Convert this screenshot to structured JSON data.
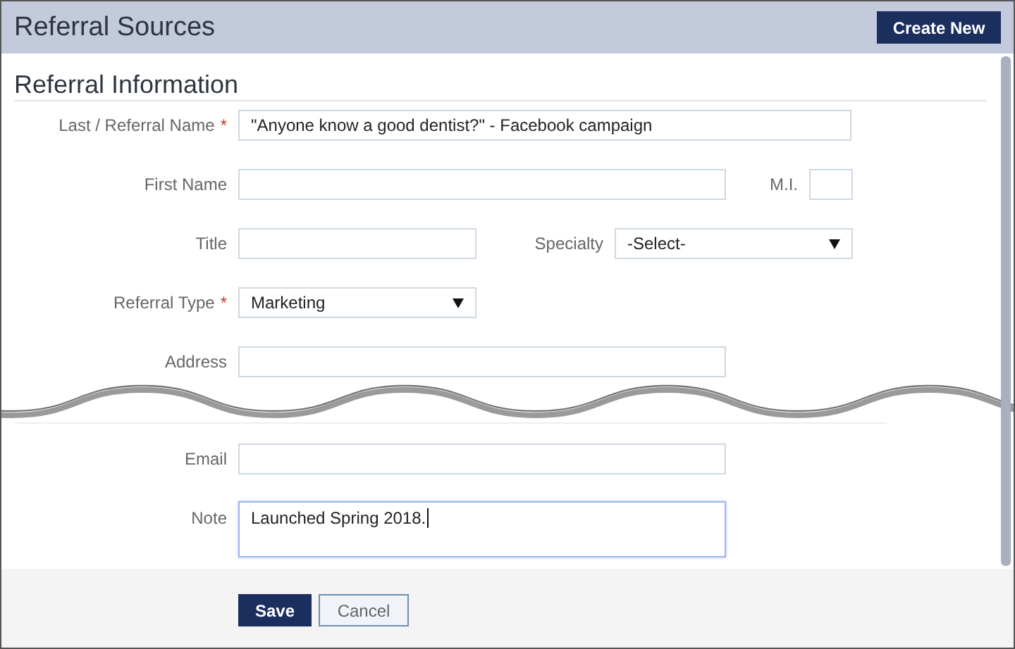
{
  "header": {
    "title": "Referral Sources",
    "create_button": "Create New"
  },
  "section": {
    "title": "Referral Information"
  },
  "last_name": {
    "label": "Last / Referral Name",
    "required_mark": "*",
    "value": "\"Anyone know a good dentist?\" - Facebook campaign"
  },
  "first_name": {
    "label": "First Name"
  },
  "middle_initial": {
    "label": "M.I."
  },
  "title": {
    "label": "Title"
  },
  "specialty": {
    "label": "Specialty",
    "value": "-Select-"
  },
  "referral_type": {
    "label": "Referral Type",
    "required_mark": "*",
    "value": "Marketing"
  },
  "address": {
    "label": "Address"
  },
  "email": {
    "label": "Email"
  },
  "note": {
    "label": "Note",
    "value": "Launched Spring 2018.",
    "focused": true
  },
  "buttons": [
    {
      "label": "Save",
      "kind": "primary"
    },
    {
      "label": "Cancel",
      "kind": "secondary"
    }
  ]
}
